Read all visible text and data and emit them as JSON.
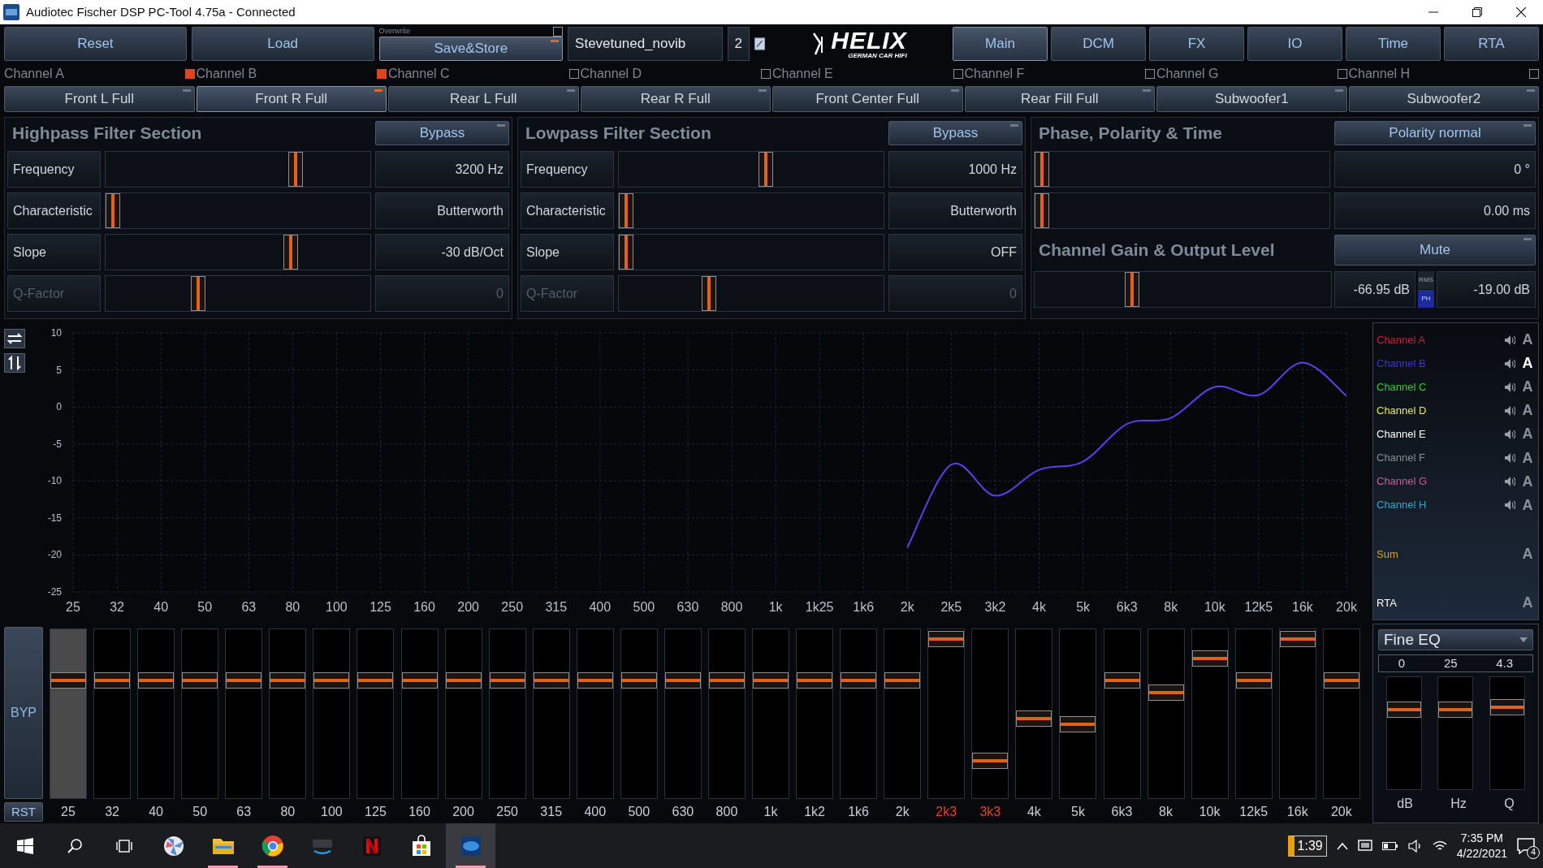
{
  "window": {
    "title": "Audiotec Fischer DSP PC-Tool 4.75a - Connected"
  },
  "toolbar": {
    "buttons": [
      "Reset",
      "Load"
    ],
    "overwrite": {
      "label": "Overwrite",
      "checked": false
    },
    "save_button": "Save&Store",
    "preset": {
      "name": "Stevetuned_novib",
      "slot": "2"
    },
    "logo": {
      "brand": "HELIX",
      "tagline": "GERMAN CAR HIFI"
    }
  },
  "tabs": [
    {
      "label": "Main",
      "selected": true
    },
    {
      "label": "DCM",
      "selected": false
    },
    {
      "label": "FX",
      "selected": false
    },
    {
      "label": "IO",
      "selected": false
    },
    {
      "label": "Time",
      "selected": false
    },
    {
      "label": "RTA",
      "selected": false
    }
  ],
  "channels": [
    {
      "name": "Channel A",
      "checked": true,
      "output": "Front L Full",
      "selected": false
    },
    {
      "name": "Channel B",
      "checked": true,
      "output": "Front R Full",
      "selected": true
    },
    {
      "name": "Channel C",
      "checked": false,
      "output": "Rear L Full",
      "selected": false
    },
    {
      "name": "Channel D",
      "checked": false,
      "output": "Rear R Full",
      "selected": false
    },
    {
      "name": "Channel E",
      "checked": false,
      "output": "Front Center Full",
      "selected": false
    },
    {
      "name": "Channel F",
      "checked": false,
      "output": "Rear Fill Full",
      "selected": false
    },
    {
      "name": "Channel G",
      "checked": false,
      "output": "Subwoofer1",
      "selected": false
    },
    {
      "name": "Channel H",
      "checked": false,
      "output": "Subwoofer2",
      "selected": false
    }
  ],
  "highpass": {
    "title": "Highpass Filter Section",
    "button": "Bypass",
    "rows": [
      {
        "label": "Frequency",
        "level": 0.73,
        "value": "3200 Hz",
        "disabled": false
      },
      {
        "label": "Characteristic",
        "level": 0.0,
        "value": "Butterworth",
        "disabled": false
      },
      {
        "label": "Slope",
        "level": 0.71,
        "value": "-30 dB/Oct",
        "disabled": false
      },
      {
        "label": "Q-Factor",
        "level": 0.34,
        "value": "0",
        "disabled": true
      }
    ]
  },
  "lowpass": {
    "title": "Lowpass Filter Section",
    "button": "Bypass",
    "rows": [
      {
        "label": "Frequency",
        "level": 0.56,
        "value": "1000 Hz",
        "disabled": false
      },
      {
        "label": "Characteristic",
        "level": 0.0,
        "value": "Butterworth",
        "disabled": false
      },
      {
        "label": "Slope",
        "level": 0.0,
        "value": "OFF",
        "disabled": false
      },
      {
        "label": "Q-Factor",
        "level": 0.33,
        "value": "0",
        "disabled": true
      }
    ]
  },
  "phase": {
    "title": "Phase, Polarity & Time",
    "button": "Polarity normal",
    "rows": [
      {
        "level": 0.0,
        "value": "0 °"
      },
      {
        "level": 0.0,
        "value": "0.00 ms"
      }
    ]
  },
  "gain": {
    "title": "Channel Gain & Output Level",
    "button": "Mute",
    "level": 0.32,
    "reading": "-66.95 dB",
    "meter_modes": [
      {
        "label": "RMS",
        "selected": false
      },
      {
        "label": "PH",
        "selected": true
      }
    ],
    "output_level": "-19.00 dB"
  },
  "graph": {
    "chart_data": {
      "type": "line",
      "grid": true,
      "ylim": [
        -25,
        10
      ],
      "categories": [
        "25",
        "32",
        "40",
        "50",
        "63",
        "80",
        "100",
        "125",
        "160",
        "200",
        "250",
        "315",
        "400",
        "500",
        "630",
        "800",
        "1k",
        "1k25",
        "1k6",
        "2k",
        "2k5",
        "3k2",
        "4k",
        "5k",
        "6k3",
        "8k",
        "10k",
        "12k5",
        "16k",
        "20k"
      ],
      "yticks": [
        -25,
        -20,
        -15,
        -10,
        -5,
        0,
        5,
        10
      ],
      "series": [
        {
          "color": "#5a40f0",
          "values": [
            null,
            null,
            null,
            null,
            null,
            null,
            null,
            null,
            null,
            null,
            null,
            null,
            null,
            null,
            null,
            null,
            null,
            null,
            null,
            -19,
            -7.8,
            -12,
            -8.5,
            -7.4,
            -2.3,
            -1.5,
            2.7,
            1.6,
            6,
            1.5
          ]
        }
      ]
    }
  },
  "legend": [
    {
      "name": "Channel A",
      "color": "#c8203c",
      "kind": "channel",
      "marker": "A",
      "active": false
    },
    {
      "name": "Channel B",
      "color": "#3c38c8",
      "kind": "channel",
      "marker": "A",
      "active": true
    },
    {
      "name": "Channel C",
      "color": "#3cc83c",
      "kind": "channel",
      "marker": "A",
      "active": false
    },
    {
      "name": "Channel D",
      "color": "#e6e660",
      "kind": "channel",
      "marker": "A",
      "active": false
    },
    {
      "name": "Channel E",
      "color": "#ffffff",
      "kind": "channel",
      "marker": "A",
      "active": false
    },
    {
      "name": "Channel F",
      "color": "#8a8f96",
      "kind": "channel",
      "marker": "A",
      "active": false
    },
    {
      "name": "Channel G",
      "color": "#c060a0",
      "kind": "channel",
      "marker": "A",
      "active": false
    },
    {
      "name": "Channel H",
      "color": "#30a8c8",
      "kind": "channel",
      "marker": "A",
      "active": false
    },
    {
      "name": "Sum",
      "color": "#c8a040",
      "kind": "summary",
      "marker": "A",
      "active": false
    },
    {
      "name": "RTA",
      "color": "#ffffff",
      "kind": "summary",
      "marker": "A",
      "active": false
    }
  ],
  "eq": {
    "bypass_button": "BYP",
    "reset_button": "RST",
    "bands": [
      {
        "label": "25",
        "level": 0.72,
        "selected": true,
        "modified": false
      },
      {
        "label": "32",
        "level": 0.72,
        "selected": false,
        "modified": false
      },
      {
        "label": "40",
        "level": 0.72,
        "selected": false,
        "modified": false
      },
      {
        "label": "50",
        "level": 0.72,
        "selected": false,
        "modified": false
      },
      {
        "label": "63",
        "level": 0.72,
        "selected": false,
        "modified": false
      },
      {
        "label": "80",
        "level": 0.72,
        "selected": false,
        "modified": false
      },
      {
        "label": "100",
        "level": 0.72,
        "selected": false,
        "modified": false
      },
      {
        "label": "125",
        "level": 0.72,
        "selected": false,
        "modified": false
      },
      {
        "label": "160",
        "level": 0.72,
        "selected": false,
        "modified": false
      },
      {
        "label": "200",
        "level": 0.72,
        "selected": false,
        "modified": false
      },
      {
        "label": "250",
        "level": 0.72,
        "selected": false,
        "modified": false
      },
      {
        "label": "315",
        "level": 0.72,
        "selected": false,
        "modified": false
      },
      {
        "label": "400",
        "level": 0.72,
        "selected": false,
        "modified": false
      },
      {
        "label": "500",
        "level": 0.72,
        "selected": false,
        "modified": false
      },
      {
        "label": "630",
        "level": 0.72,
        "selected": false,
        "modified": false
      },
      {
        "label": "800",
        "level": 0.72,
        "selected": false,
        "modified": false
      },
      {
        "label": "1k",
        "level": 0.72,
        "selected": false,
        "modified": false
      },
      {
        "label": "1k2",
        "level": 0.72,
        "selected": false,
        "modified": false
      },
      {
        "label": "1k6",
        "level": 0.72,
        "selected": false,
        "modified": false
      },
      {
        "label": "2k",
        "level": 0.72,
        "selected": false,
        "modified": false
      },
      {
        "label": "2k3",
        "level": 0.99,
        "selected": false,
        "modified": true
      },
      {
        "label": "3k3",
        "level": 0.19,
        "selected": false,
        "modified": true
      },
      {
        "label": "4k",
        "level": 0.47,
        "selected": false,
        "modified": false
      },
      {
        "label": "5k",
        "level": 0.43,
        "selected": false,
        "modified": false
      },
      {
        "label": "6k3",
        "level": 0.72,
        "selected": false,
        "modified": false
      },
      {
        "label": "8k",
        "level": 0.64,
        "selected": false,
        "modified": false
      },
      {
        "label": "10k",
        "level": 0.86,
        "selected": false,
        "modified": false
      },
      {
        "label": "12k5",
        "level": 0.72,
        "selected": false,
        "modified": false
      },
      {
        "label": "16k",
        "level": 0.99,
        "selected": false,
        "modified": false
      },
      {
        "label": "20k",
        "level": 0.72,
        "selected": false,
        "modified": false
      }
    ]
  },
  "fine_eq": {
    "mode": "Fine EQ",
    "sliders": [
      {
        "value": "0",
        "label": "dB",
        "level": 0.75
      },
      {
        "value": "25",
        "label": "Hz",
        "level": 0.75
      },
      {
        "value": "4.3",
        "label": "Q",
        "level": 0.77
      }
    ]
  },
  "taskbar": {
    "apps": [
      {
        "kind": "pinwheel",
        "running": false,
        "active": false
      },
      {
        "kind": "folder",
        "running": true,
        "active": false
      },
      {
        "kind": "browser",
        "running": true,
        "active": false
      },
      {
        "kind": "video",
        "running": false,
        "active": false
      },
      {
        "kind": "tile",
        "running": false,
        "active": false
      },
      {
        "kind": "store",
        "running": false,
        "active": false
      },
      {
        "kind": "dsp",
        "running": true,
        "active": true
      }
    ],
    "tray": {
      "badge": "1:39",
      "time": "7:35 PM",
      "date": "4/22/2021",
      "notifications": "4"
    }
  }
}
